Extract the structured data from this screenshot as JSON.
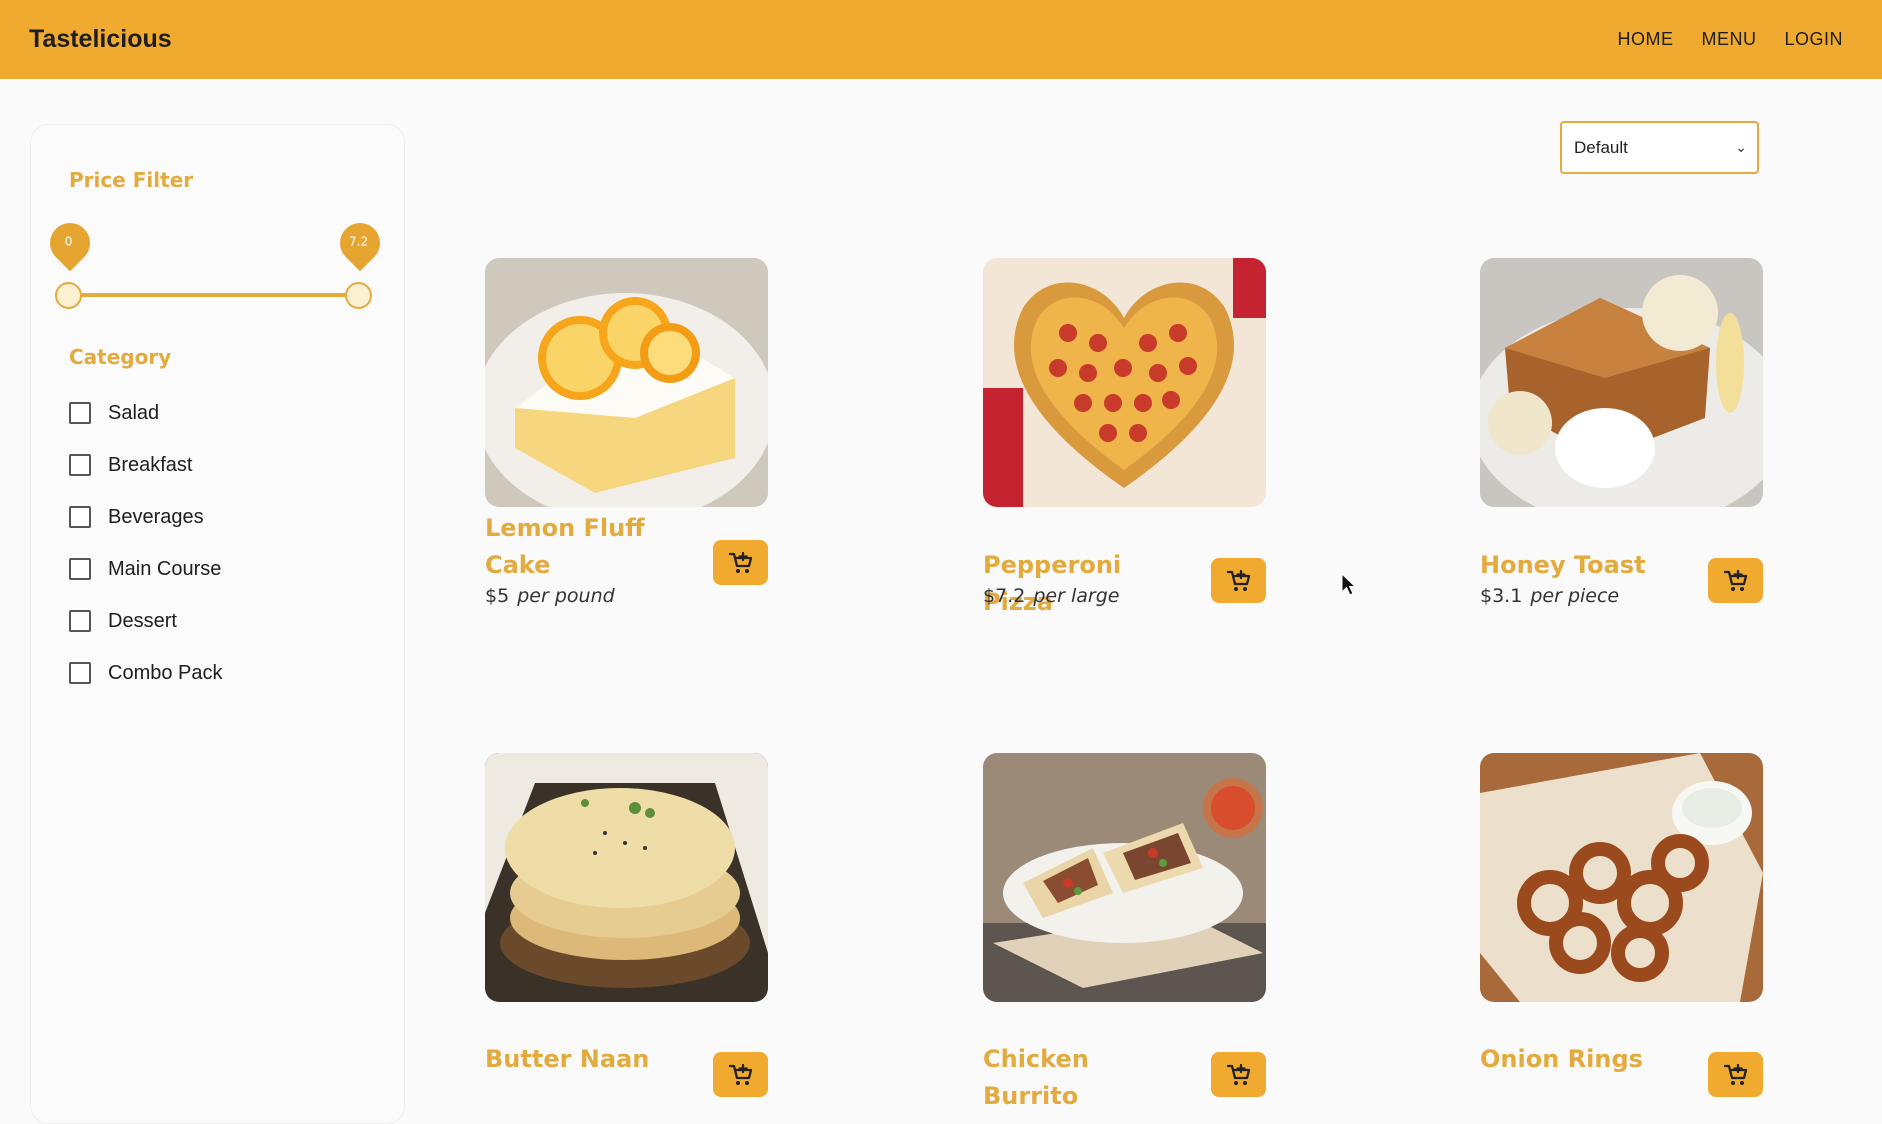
{
  "header": {
    "brand": "Tastelicious",
    "nav": [
      "HOME",
      "MENU",
      "LOGIN"
    ],
    "bg_color": "#efaa2f"
  },
  "filters": {
    "price_title": "Price Filter",
    "price_min": "0",
    "price_max": "7.2",
    "category_title": "Category",
    "categories": [
      "Salad",
      "Breakfast",
      "Beverages",
      "Main Course",
      "Dessert",
      "Combo Pack"
    ]
  },
  "sort": {
    "selected": "Default"
  },
  "products": [
    {
      "name": "Lemon Fluff Cake",
      "price": "$5",
      "unit": "per pound"
    },
    {
      "name": "Pepperoni Pizza",
      "price": "$7.2",
      "unit": "per large"
    },
    {
      "name": "Honey Toast",
      "price": "$3.1",
      "unit": "per piece"
    },
    {
      "name": "Butter Naan",
      "price": "",
      "unit": ""
    },
    {
      "name": "Chicken Burrito",
      "price": "",
      "unit": ""
    },
    {
      "name": "Onion Rings",
      "price": "",
      "unit": ""
    }
  ],
  "accent_color": "#e3aa3e",
  "icons": {
    "cart": "add-to-cart-icon",
    "select": "chevron-down-icon"
  }
}
